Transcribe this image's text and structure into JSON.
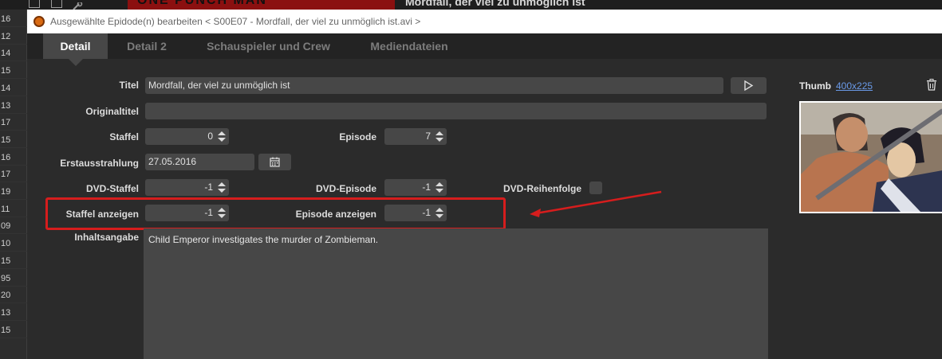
{
  "background": {
    "title": "Mordfall, der viel zu unmöglich ist",
    "row_numbers": [
      "16",
      "12",
      "14",
      "15",
      "14",
      "13",
      "17",
      "15",
      "16",
      "17",
      "19",
      "11",
      "09",
      "10",
      "15",
      "95",
      "20",
      "13",
      "15"
    ]
  },
  "window": {
    "title": "Ausgewählte Epidode(n) bearbeiten  < S00E07 - Mordfall, der viel zu unmöglich ist.avi >"
  },
  "tabs": [
    {
      "label": "Detail",
      "active": true
    },
    {
      "label": "Detail 2",
      "active": false
    },
    {
      "label": "Schauspieler und Crew",
      "active": false
    },
    {
      "label": "Mediendateien",
      "active": false
    }
  ],
  "form": {
    "titel_label": "Titel",
    "titel_value": "Mordfall, der viel zu unmöglich ist",
    "originaltitel_label": "Originaltitel",
    "originaltitel_value": "",
    "staffel_label": "Staffel",
    "staffel_value": "0",
    "episode_label": "Episode",
    "episode_value": "7",
    "erstausstrahlung_label": "Erstausstrahlung",
    "erstausstrahlung_value": "27.05.2016",
    "dvd_staffel_label": "DVD-Staffel",
    "dvd_staffel_value": "-1",
    "dvd_episode_label": "DVD-Episode",
    "dvd_episode_value": "-1",
    "dvd_reihenfolge_label": "DVD-Reihenfolge",
    "staffel_anzeigen_label": "Staffel anzeigen",
    "staffel_anzeigen_value": "-1",
    "episode_anzeigen_label": "Episode anzeigen",
    "episode_anzeigen_value": "-1",
    "inhaltsangabe_label": "Inhaltsangabe",
    "inhaltsangabe_value": "Child Emperor investigates the murder of Zombieman."
  },
  "thumb": {
    "label": "Thumb",
    "size_link": "400x225"
  },
  "icons": {
    "play": "play-icon",
    "calendar": "calendar-icon",
    "trash": "trash-icon"
  },
  "colors": {
    "highlight": "#d61d1d",
    "link": "#6a9ae8",
    "app_icon": "#d96a12"
  }
}
